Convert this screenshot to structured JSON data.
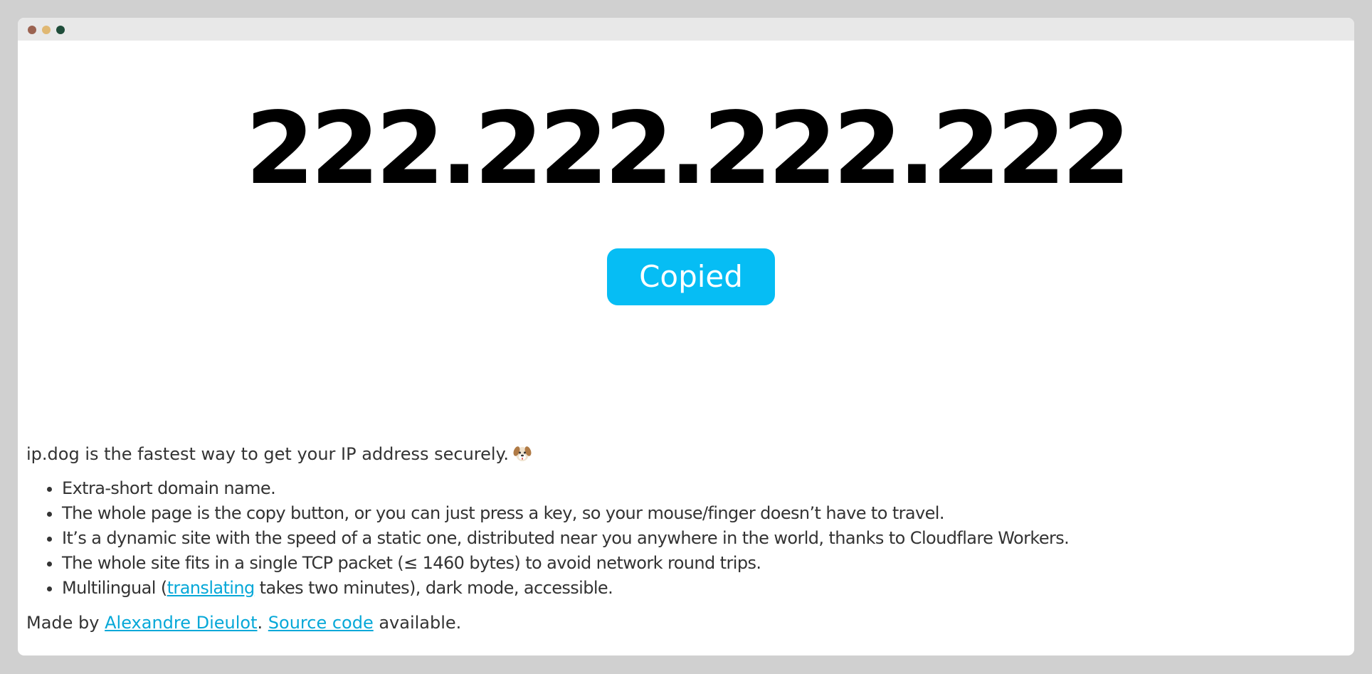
{
  "ip_address": "222.222.222.222",
  "copy_button": {
    "label": "Copied",
    "color": "#06bdf4"
  },
  "intro": {
    "text": "ip.dog is the fastest way to get your IP address securely.",
    "icon": "dog-face-icon"
  },
  "features": [
    "Extra-short domain name.",
    "The whole page is the copy button, or you can just press a key, so your mouse/finger doesn’t have to travel.",
    "It’s a dynamic site with the speed of a static one, distributed near you anywhere in the world, thanks to Cloudflare Workers.",
    "The whole site fits in a single TCP packet (≤ 1460 bytes) to avoid network round trips."
  ],
  "multilingual": {
    "before": "Multilingual (",
    "link": "translating",
    "after": " takes two minutes), dark mode, accessible."
  },
  "footer": {
    "prefix": "Made by ",
    "author_link": "Alexandre Dieulot",
    "separator": ". ",
    "source_link": "Source code",
    "suffix": " available."
  },
  "colors": {
    "background": "#d0d0d0",
    "titlebar": "#e8e8e8",
    "text": "#333333",
    "link": "#06a8d8",
    "window_dots": [
      "#9b6351",
      "#e0b873",
      "#1f4d3a"
    ]
  }
}
